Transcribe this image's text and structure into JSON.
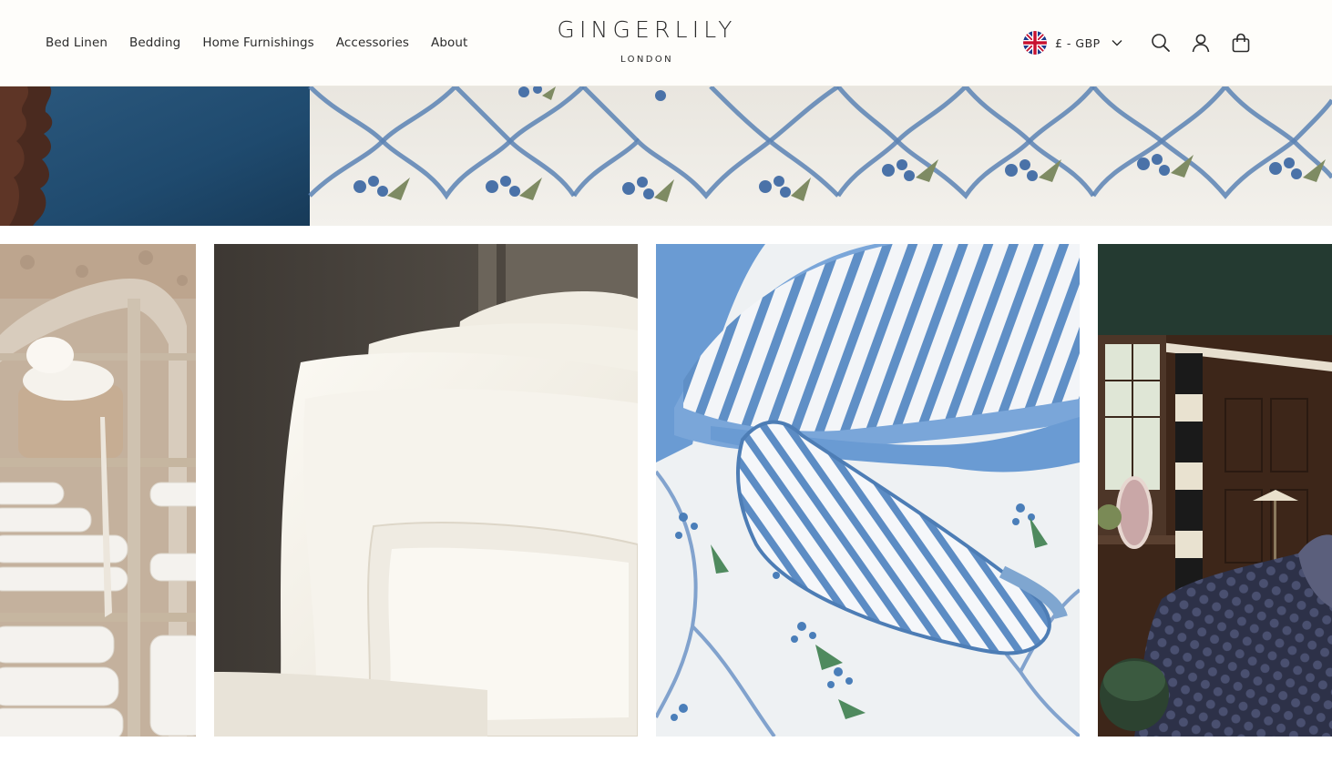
{
  "nav": {
    "items": [
      {
        "label": "Bed Linen"
      },
      {
        "label": "Bedding"
      },
      {
        "label": "Home Furnishings"
      },
      {
        "label": "Accessories"
      },
      {
        "label": "About"
      }
    ]
  },
  "logo": {
    "brand": "GINGERLILY",
    "sub": "LONDON"
  },
  "currency": {
    "label": "£ - GBP",
    "flag_icon": "uk-flag-icon"
  },
  "header_icons": [
    "search-icon",
    "account-icon",
    "cart-icon"
  ],
  "colors": {
    "header_bg": "#fefdfa",
    "text": "#2a2a2a",
    "velvet_blue": "#1f4a6e",
    "trellis_blue": "#5b82b4",
    "silk_ivory": "#f1ede3",
    "stripe_blue": "#5f8fc6"
  },
  "tiles": [
    {
      "image": "linen-cupboard-pillows"
    },
    {
      "image": "ivory-silk-pillows"
    },
    {
      "image": "striped-eye-mask-bedding"
    },
    {
      "image": "navy-quilted-bedroom"
    }
  ]
}
